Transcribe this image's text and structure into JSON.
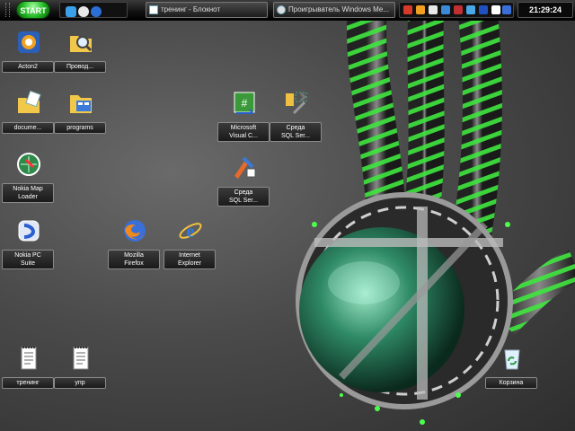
{
  "taskbar": {
    "start_label": "START",
    "tasks": [
      {
        "label": "тренинг - Блокнот"
      },
      {
        "label": "Проигрыватель Windows Me..."
      }
    ],
    "clock": "21:29:24"
  },
  "desktop": {
    "icons": [
      {
        "label": "Acton2"
      },
      {
        "label": "Провод..."
      },
      {
        "label": "docume..."
      },
      {
        "label": "programs"
      },
      {
        "label": "Microsoft\nVisual C..."
      },
      {
        "label": "Среда\nSQL Ser..."
      },
      {
        "label": "Nokia Map\nLoader"
      },
      {
        "label": "Среда\nSQL Ser..."
      },
      {
        "label": "Nokia PC\nSuite"
      },
      {
        "label": "Mozilla\nFirefox"
      },
      {
        "label": "Internet\nExplorer"
      },
      {
        "label": "тренинг"
      },
      {
        "label": "упр"
      },
      {
        "label": "Корзина"
      }
    ]
  },
  "colors": {
    "accent": "#22c422",
    "taskbar": "#111111"
  }
}
